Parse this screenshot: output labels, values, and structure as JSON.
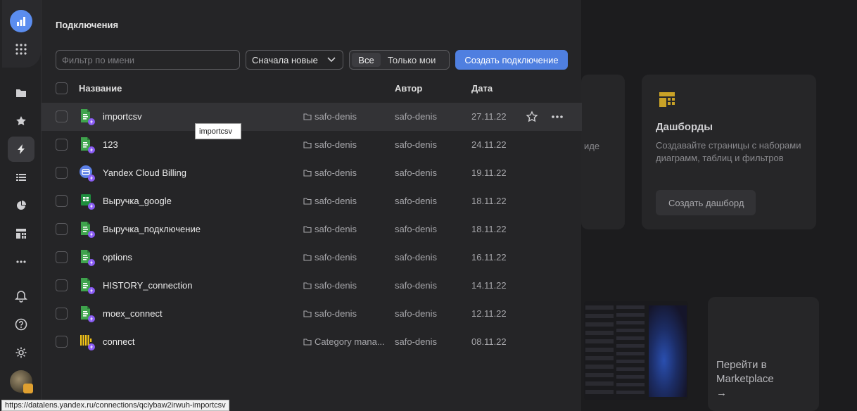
{
  "panel": {
    "title": "Подключения",
    "filter_placeholder": "Фильтр по имени",
    "sort_value": "Сначала новые",
    "scope_all": "Все",
    "scope_mine": "Только мои",
    "create_button": "Создать подключение",
    "columns": {
      "name": "Название",
      "author": "Автор",
      "date": "Дата"
    }
  },
  "rows": [
    {
      "name": "importcsv",
      "folder": "safo-denis",
      "author": "safo-denis",
      "date": "27.11.22",
      "icon": "file-connection-icon"
    },
    {
      "name": "123",
      "folder": "safo-denis",
      "author": "safo-denis",
      "date": "24.11.22",
      "icon": "file-connection-icon"
    },
    {
      "name": "Yandex Cloud Billing",
      "folder": "safo-denis",
      "author": "safo-denis",
      "date": "19.11.22",
      "icon": "billing-connection-icon"
    },
    {
      "name": "Выручка_google",
      "folder": "safo-denis",
      "author": "safo-denis",
      "date": "18.11.22",
      "icon": "google-sheets-connection-icon"
    },
    {
      "name": "Выручка_подключение",
      "folder": "safo-denis",
      "author": "safo-denis",
      "date": "18.11.22",
      "icon": "file-connection-icon"
    },
    {
      "name": "options",
      "folder": "safo-denis",
      "author": "safo-denis",
      "date": "16.11.22",
      "icon": "file-connection-icon"
    },
    {
      "name": "HISTORY_connection",
      "folder": "safo-denis",
      "author": "safo-denis",
      "date": "14.11.22",
      "icon": "file-connection-icon"
    },
    {
      "name": "moex_connect",
      "folder": "safo-denis",
      "author": "safo-denis",
      "date": "12.11.22",
      "icon": "file-connection-icon"
    },
    {
      "name": "connect",
      "folder": "Category mana...",
      "author": "safo-denis",
      "date": "08.11.22",
      "icon": "clickhouse-connection-icon"
    }
  ],
  "tooltip": "importcsv",
  "status_url": "https://datalens.yandex.ru/connections/qciybaw2irwuh-importcsv",
  "background": {
    "dashboards_title": "Дашборды",
    "dashboards_desc_1": "Создавайте страницы с наборами",
    "dashboards_desc_2": "диаграмм, таблиц и фильтров",
    "dashboards_button": "Создать дашборд",
    "partial_text": "иде",
    "marketplace_1": "Перейти в",
    "marketplace_2": "Marketplace",
    "marketplace_arrow": "→"
  },
  "colors": {
    "accent": "#4f7fe0",
    "file_icon": "#3fa34d",
    "badge": "#8a5cf5"
  }
}
